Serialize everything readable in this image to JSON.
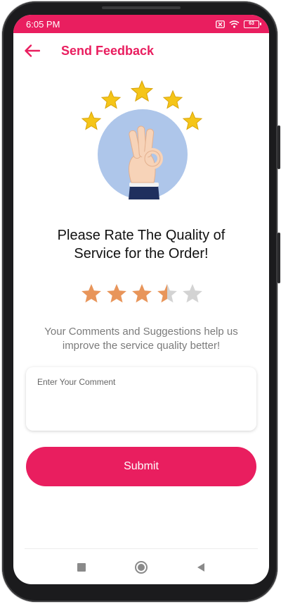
{
  "status_bar": {
    "time": "6:05 PM",
    "battery": "63",
    "icons": [
      "sim-x-icon",
      "wifi-icon",
      "battery-icon"
    ]
  },
  "app_bar": {
    "title": "Send Feedback",
    "back_icon": "back-arrow-icon"
  },
  "colors": {
    "accent": "#e91e5f",
    "star_filled": "#e8955a",
    "star_empty": "#d3d3d3",
    "illustration_bg": "#aec6ea"
  },
  "headline": "Please Rate The Quality of Service for the Order!",
  "rating": {
    "value": 3.5,
    "max": 5
  },
  "subtext": "Your Comments and Suggestions help us improve the service quality better!",
  "comment": {
    "placeholder": "Enter Your Comment",
    "value": ""
  },
  "submit_label": "Submit",
  "nav": {
    "icons": [
      "recent-apps-icon",
      "home-icon",
      "back-icon"
    ]
  }
}
